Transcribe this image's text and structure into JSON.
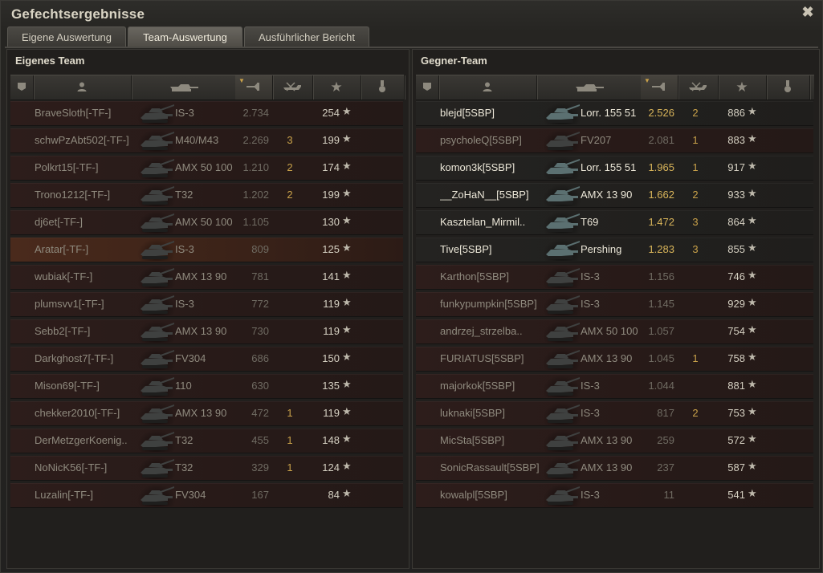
{
  "window": {
    "title": "Gefechtsergebnisse"
  },
  "tabs": [
    {
      "label": "Eigene Auswertung",
      "active": false
    },
    {
      "label": "Team-Auswertung",
      "active": true
    },
    {
      "label": "Ausführlicher Bericht",
      "active": false
    }
  ],
  "header_icons": [
    "platoon-icon",
    "player-icon",
    "tank-icon",
    "damage-icon",
    "kills-icon",
    "xp-star-icon",
    "medal-icon"
  ],
  "own_team": {
    "title": "Eigenes Team",
    "players": [
      {
        "name": "BraveSloth[-TF-]",
        "tank": "IS-3",
        "damage": "2.734",
        "kills": "",
        "xp": "254",
        "alive": false,
        "self": false
      },
      {
        "name": "schwPzAbt502[-TF-]",
        "tank": "M40/M43",
        "damage": "2.269",
        "kills": "3",
        "xp": "199",
        "alive": false,
        "self": false
      },
      {
        "name": "Polkrt15[-TF-]",
        "tank": "AMX 50 100",
        "damage": "1.210",
        "kills": "2",
        "xp": "174",
        "alive": false,
        "self": false
      },
      {
        "name": "Trono1212[-TF-]",
        "tank": "T32",
        "damage": "1.202",
        "kills": "2",
        "xp": "199",
        "alive": false,
        "self": false
      },
      {
        "name": "dj6et[-TF-]",
        "tank": "AMX 50 100",
        "damage": "1.105",
        "kills": "",
        "xp": "130",
        "alive": false,
        "self": false
      },
      {
        "name": "Aratar[-TF-]",
        "tank": "IS-3",
        "damage": "809",
        "kills": "",
        "xp": "125",
        "alive": false,
        "self": true
      },
      {
        "name": "wubiak[-TF-]",
        "tank": "AMX 13 90",
        "damage": "781",
        "kills": "",
        "xp": "141",
        "alive": false,
        "self": false
      },
      {
        "name": "plumsvv1[-TF-]",
        "tank": "IS-3",
        "damage": "772",
        "kills": "",
        "xp": "119",
        "alive": false,
        "self": false
      },
      {
        "name": "Sebb2[-TF-]",
        "tank": "AMX 13 90",
        "damage": "730",
        "kills": "",
        "xp": "119",
        "alive": false,
        "self": false
      },
      {
        "name": "Darkghost7[-TF-]",
        "tank": "FV304",
        "damage": "686",
        "kills": "",
        "xp": "150",
        "alive": false,
        "self": false
      },
      {
        "name": "Mison69[-TF-]",
        "tank": "110",
        "damage": "630",
        "kills": "",
        "xp": "135",
        "alive": false,
        "self": false
      },
      {
        "name": "chekker2010[-TF-]",
        "tank": "AMX 13 90",
        "damage": "472",
        "kills": "1",
        "xp": "119",
        "alive": false,
        "self": false
      },
      {
        "name": "DerMetzgerKoenig..",
        "tank": "T32",
        "damage": "455",
        "kills": "1",
        "xp": "148",
        "alive": false,
        "self": false
      },
      {
        "name": "NoNicK56[-TF-]",
        "tank": "T32",
        "damage": "329",
        "kills": "1",
        "xp": "124",
        "alive": false,
        "self": false
      },
      {
        "name": "Luzalin[-TF-]",
        "tank": "FV304",
        "damage": "167",
        "kills": "",
        "xp": "84",
        "alive": false,
        "self": false
      }
    ]
  },
  "enemy_team": {
    "title": "Gegner-Team",
    "players": [
      {
        "name": "blejd[5SBP]",
        "tank": "Lorr. 155 51",
        "damage": "2.526",
        "kills": "2",
        "xp": "886",
        "alive": true
      },
      {
        "name": "psycholeQ[5SBP]",
        "tank": "FV207",
        "damage": "2.081",
        "kills": "1",
        "xp": "883",
        "alive": false
      },
      {
        "name": "komon3k[5SBP]",
        "tank": "Lorr. 155 51",
        "damage": "1.965",
        "kills": "1",
        "xp": "917",
        "alive": true
      },
      {
        "name": "__ZoHaN__[5SBP]",
        "tank": "AMX 13 90",
        "damage": "1.662",
        "kills": "2",
        "xp": "933",
        "alive": true
      },
      {
        "name": "Kasztelan_Mirmil..",
        "tank": "T69",
        "damage": "1.472",
        "kills": "3",
        "xp": "864",
        "alive": true
      },
      {
        "name": "Tive[5SBP]",
        "tank": "Pershing",
        "damage": "1.283",
        "kills": "3",
        "xp": "855",
        "alive": true
      },
      {
        "name": "Karthon[5SBP]",
        "tank": "IS-3",
        "damage": "1.156",
        "kills": "",
        "xp": "746",
        "alive": false
      },
      {
        "name": "funkypumpkin[5SBP]",
        "tank": "IS-3",
        "damage": "1.145",
        "kills": "",
        "xp": "929",
        "alive": false
      },
      {
        "name": "andrzej_strzelba..",
        "tank": "AMX 50 100",
        "damage": "1.057",
        "kills": "",
        "xp": "754",
        "alive": false
      },
      {
        "name": "FURIATUS[5SBP]",
        "tank": "AMX 13 90",
        "damage": "1.045",
        "kills": "1",
        "xp": "758",
        "alive": false
      },
      {
        "name": "majorkok[5SBP]",
        "tank": "IS-3",
        "damage": "1.044",
        "kills": "",
        "xp": "881",
        "alive": false
      },
      {
        "name": "luknaki[5SBP]",
        "tank": "IS-3",
        "damage": "817",
        "kills": "2",
        "xp": "753",
        "alive": false
      },
      {
        "name": "MicSta[5SBP]",
        "tank": "AMX 13 90",
        "damage": "259",
        "kills": "",
        "xp": "572",
        "alive": false
      },
      {
        "name": "SonicRassault[5SBP]",
        "tank": "AMX 13 90",
        "damage": "237",
        "kills": "",
        "xp": "587",
        "alive": false
      },
      {
        "name": "kowalpl[5SBP]",
        "tank": "IS-3",
        "damage": "11",
        "kills": "",
        "xp": "541",
        "alive": false
      }
    ]
  },
  "colors": {
    "damage_alive": "#d8b45a",
    "kills": "#c9a24a",
    "self_row": "#4a2a1c",
    "dead_row": "#2d1d1b"
  }
}
